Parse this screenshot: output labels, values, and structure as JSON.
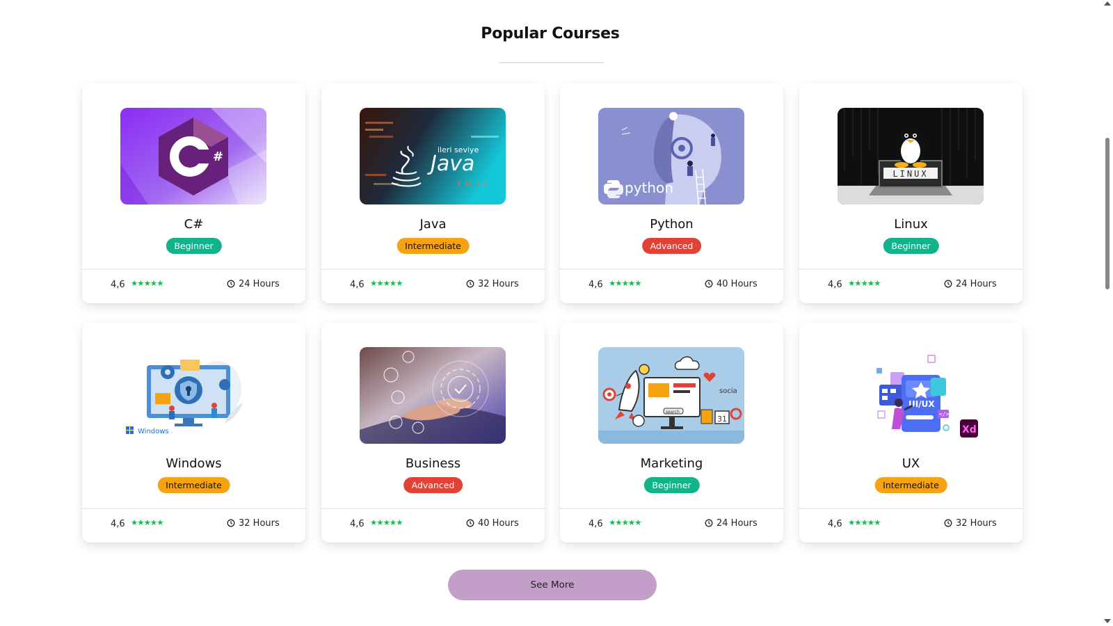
{
  "page": {
    "title": "Popular Courses",
    "see_more_label": "See More"
  },
  "courses": [
    {
      "name": "C#",
      "level": "Beginner",
      "level_kind": "beginner",
      "rating": "4,6",
      "stars": 5,
      "duration": "24 Hours",
      "image_icon": "csharp-logo-image"
    },
    {
      "name": "Java",
      "level": "Intermediate",
      "level_kind": "intermediate",
      "rating": "4,6",
      "stars": 5,
      "duration": "32 Hours",
      "image_icon": "java-code-image",
      "image_text": "ileri seviye",
      "image_word": "Java",
      "image_digits": "0 10 1 0"
    },
    {
      "name": "Python",
      "level": "Advanced",
      "level_kind": "advanced",
      "rating": "4,6",
      "stars": 5,
      "duration": "40 Hours",
      "image_icon": "python-ai-image",
      "image_word": "python"
    },
    {
      "name": "Linux",
      "level": "Beginner",
      "level_kind": "beginner",
      "rating": "4,6",
      "stars": 5,
      "duration": "24 Hours",
      "image_icon": "linux-laptop-image",
      "image_word": "LINUX"
    },
    {
      "name": "Windows",
      "level": "Intermediate",
      "level_kind": "intermediate",
      "rating": "4,6",
      "stars": 5,
      "duration": "32 Hours",
      "image_icon": "windows-security-image",
      "image_word": "Windows"
    },
    {
      "name": "Business",
      "level": "Advanced",
      "level_kind": "advanced",
      "rating": "4,6",
      "stars": 5,
      "duration": "40 Hours",
      "image_icon": "business-typing-image"
    },
    {
      "name": "Marketing",
      "level": "Beginner",
      "level_kind": "beginner",
      "rating": "4,6",
      "stars": 5,
      "duration": "24 Hours",
      "image_icon": "marketing-illustration-image",
      "image_word": "search",
      "image_social": "socia",
      "image_date": "31"
    },
    {
      "name": "UX",
      "level": "Intermediate",
      "level_kind": "intermediate",
      "rating": "4,6",
      "stars": 5,
      "duration": "32 Hours",
      "image_icon": "ux-design-image",
      "image_word": "UI/UX",
      "image_badge": "Xd"
    }
  ],
  "colors": {
    "beginner": "#12b38a",
    "intermediate": "#f5a313",
    "advanced": "#e24236",
    "stars": "#1db954",
    "see_more_bg": "#c39ec9"
  }
}
